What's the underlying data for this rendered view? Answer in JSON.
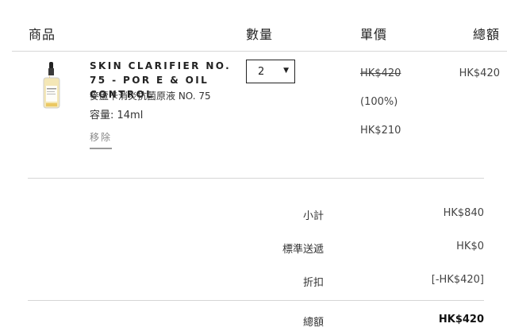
{
  "header": {
    "product": "商品",
    "quantity": "數量",
    "unit_price": "單價",
    "total": "總額"
  },
  "item": {
    "name": "SKIN CLARIFIER NO. 75 - POR E & OIL CONTROL",
    "subtitle": "麥蘆卡消炎抗菌原液 NO. 75",
    "volume": "容量: 14ml",
    "remove": "移除",
    "quantity": "2",
    "original_price": "HK$420",
    "discount_percent": "(100%)",
    "final_price": "HK$210",
    "line_total": "HK$420"
  },
  "summary": {
    "subtotal_label": "小計",
    "subtotal_value": "HK$840",
    "shipping_label": "標準送遞",
    "shipping_value": "HK$0",
    "discount_label": "折扣",
    "discount_value": "[-HK$420]",
    "total_label": "總額",
    "total_value": "HK$420"
  }
}
